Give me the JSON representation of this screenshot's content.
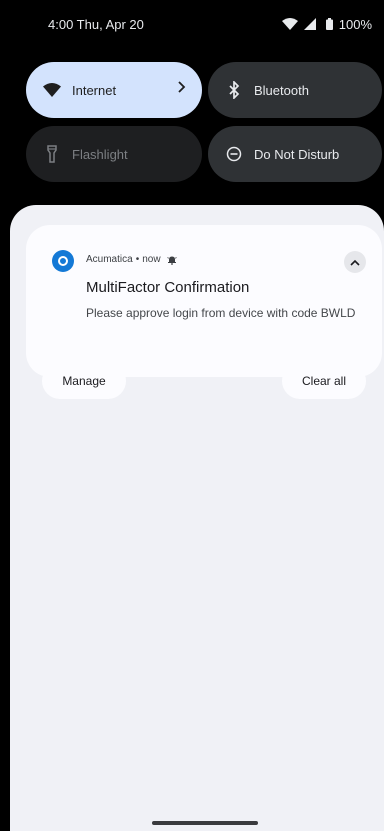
{
  "status_bar": {
    "time_date": "4:00 Thu, Apr 20",
    "battery": "100%"
  },
  "quick_settings": {
    "tiles": [
      {
        "label": "Internet",
        "icon": "wifi-icon",
        "state": "on"
      },
      {
        "label": "Bluetooth",
        "icon": "bluetooth-icon",
        "state": "off"
      },
      {
        "label": "Flashlight",
        "icon": "flashlight-icon",
        "state": "unavailable"
      },
      {
        "label": "Do Not Disturb",
        "icon": "dnd-icon",
        "state": "off"
      }
    ]
  },
  "notification": {
    "app_name": "Acumatica",
    "separator": "•",
    "time": "now",
    "title": "MultiFactor Confirmation",
    "body": "Please approve login from device with code BWLD",
    "app_icon_color": "#1479d6"
  },
  "actions": {
    "manage_label": "Manage",
    "clear_all_label": "Clear all"
  },
  "colors": {
    "active_tile": "#d3e3fd",
    "inactive_tile": "#2f3235",
    "shade_background": "#f0f1f6"
  }
}
